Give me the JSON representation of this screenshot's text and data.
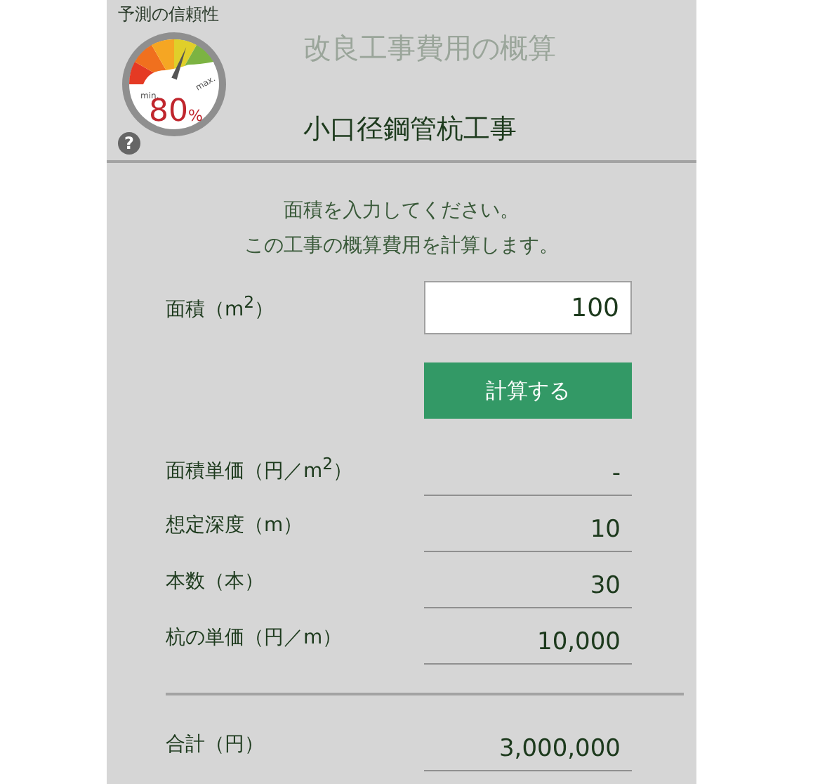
{
  "gauge": {
    "label": "予測の信頼性",
    "min_label": "min.",
    "max_label": "max.",
    "reading": "80",
    "unit": "%",
    "help_icon": "?"
  },
  "title": "改良工事費用の概算",
  "subtitle": "小口径鋼管杭工事",
  "instructions": [
    "面積を入力してください。",
    "この工事の概算費用を計算します。"
  ],
  "area_field": {
    "label": "面積（m$^{2}$）",
    "value": "100"
  },
  "calculate_button": "計算する",
  "results": [
    {
      "label": "面積単価（円／m$^{2}$）",
      "value": "-"
    },
    {
      "label": "想定深度（m）",
      "value": "10"
    },
    {
      "label": "本数（本）",
      "value": "30"
    },
    {
      "label": "杭の単価（円／m）",
      "value": "10,000"
    }
  ],
  "total": {
    "label": "合計（円）",
    "value": "3,000,000"
  }
}
